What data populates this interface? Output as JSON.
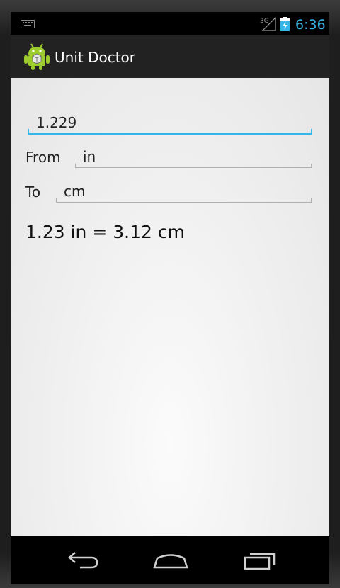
{
  "status_bar": {
    "network": "3G",
    "time": "6:36"
  },
  "action_bar": {
    "title": "Unit Doctor",
    "icon": "android-robot-icon"
  },
  "form": {
    "amount_value": "1.229",
    "from_label": "From",
    "from_value": "in",
    "to_label": "To",
    "to_value": "cm"
  },
  "result_text": "1.23 in = 3.12 cm",
  "navigation": {
    "back": "back-icon",
    "home": "home-icon",
    "recents": "recents-icon"
  },
  "colors": {
    "accent": "#33b5e5",
    "action_bar": "#222222"
  }
}
